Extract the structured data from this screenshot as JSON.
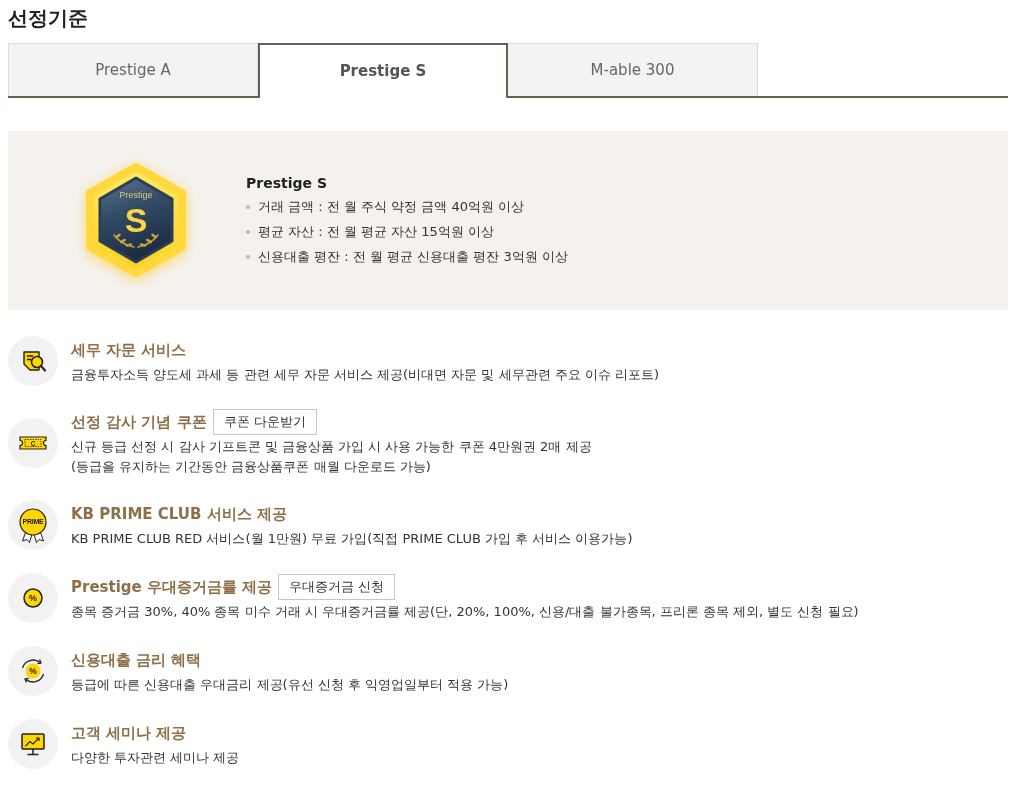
{
  "page_title": "선정기준",
  "tabs": [
    {
      "label": "Prestige A",
      "selected": false
    },
    {
      "label": "Prestige S",
      "selected": true
    },
    {
      "label": "M-able 300",
      "selected": false
    }
  ],
  "grade": {
    "badge": {
      "caption": "Prestige",
      "letter": "S"
    },
    "name": "Prestige S",
    "criteria": [
      "거래 금액 : 전 월 주식 약정 금액 40억원 이상",
      "평균 자산 : 전 월 평균 자산 15억원 이상",
      "신용대출 평잔 : 전 월 평균 신용대출 평잔 3억원 이상"
    ]
  },
  "benefits": [
    {
      "kind": "tax",
      "title": "세무 자문 서비스",
      "description": "금융투자소득 양도세 과세 등 관련 세무 자문 서비스 제공(비대면 자문 및 세무관련 주요 이슈 리포트)"
    },
    {
      "kind": "coupon",
      "icon_text": "C",
      "title": "선정 감사 기념 쿠폰",
      "button": "쿠폰 다운받기",
      "description": "신규 등급 선정 시 감사 기프트콘 및 금융상품 가입 시 사용 가능한 쿠폰 4만원권 2매 제공\n(등급을 유지하는 기간동안 금융상품쿠폰 매월 다운로드 가능)"
    },
    {
      "kind": "prime",
      "icon_text": "PRIME",
      "title": "KB PRIME CLUB 서비스 제공",
      "description": "KB PRIME CLUB RED 서비스(월 1만원) 무료 가입(직접 PRIME CLUB 가입 후 서비스 이용가능)"
    },
    {
      "kind": "margin",
      "icon_text": "%",
      "title": "Prestige 우대증거금률 제공",
      "button": "우대증거금 신청",
      "description": "종목 증거금 30%, 40% 종목 미수 거래 시 우대증거금률 제공(단, 20%, 100%, 신용/대출 불가종목, 프리론 종목 제외, 별도 신청 필요)"
    },
    {
      "kind": "loan",
      "icon_text": "%",
      "title": "신용대출 금리 혜택",
      "description": "등급에 따른 신용대출 우대금리 제공(유선 신청 후 익영업일부터 적용 가능)"
    },
    {
      "kind": "seminar",
      "title": "고객 세미나 제공",
      "description": "다양한 투자관련 세미나 제공"
    }
  ]
}
